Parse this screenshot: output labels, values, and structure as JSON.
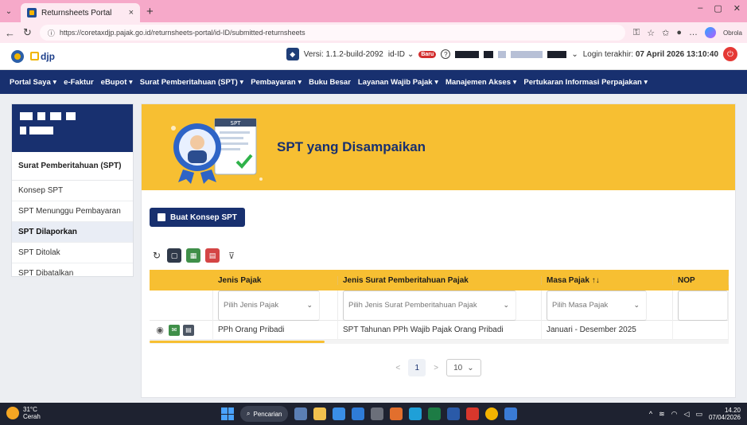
{
  "browser": {
    "tab_title": "Returnsheets Portal",
    "tab_close": "×",
    "new_tab": "+",
    "url": "https://coretaxdjp.pajak.go.id/returnsheets-portal/id-ID/submitted-returnsheets",
    "profile_label": "Obrola"
  },
  "header": {
    "logo_text": "djp",
    "version_label": "Versi: 1.1.2-build-2092",
    "language": "id-ID",
    "new_badge": "Baru",
    "help": "?",
    "login_prefix": "Login terakhir:",
    "login_time": "07 April 2026 13:10:40"
  },
  "menu": [
    "Portal Saya ▾",
    "e-Faktur",
    "eBupot ▾",
    "Surat Pemberitahuan (SPT) ▾",
    "Pembayaran ▾",
    "Buku Besar",
    "Layanan Wajib Pajak ▾",
    "Manajemen Akses ▾",
    "Pertukaran Informasi Perpajakan ▾"
  ],
  "sidebar": {
    "title": "Surat Pemberitahuan (SPT)",
    "items": [
      {
        "label": "Konsep SPT",
        "active": false
      },
      {
        "label": "SPT Menunggu Pembayaran",
        "active": false
      },
      {
        "label": "SPT Dilaporkan",
        "active": true
      },
      {
        "label": "SPT Ditolak",
        "active": false
      },
      {
        "label": "SPT Dibatalkan",
        "active": false
      }
    ]
  },
  "banner": {
    "title": "SPT yang Disampaikan",
    "illus_badge": "SPT"
  },
  "actions": {
    "new_draft": "Buat Konsep SPT"
  },
  "table": {
    "columns": [
      "",
      "Jenis Pajak",
      "Jenis Surat Pemberitahuan Pajak",
      "Masa Pajak ↑↓",
      "NOP"
    ],
    "filters": {
      "jenis_pajak": "Pilih Jenis Pajak",
      "jenis_spt": "Pilih Jenis Surat Pemberitahuan Pajak",
      "masa_pajak": "Pilih Masa Pajak"
    },
    "rows": [
      {
        "jenis_pajak": "PPh Orang Pribadi",
        "jenis_spt": "SPT Tahunan PPh Wajib Pajak Orang Pribadi",
        "masa_pajak": "Januari - Desember 2025",
        "nop": ""
      }
    ]
  },
  "pager": {
    "prev": "<",
    "current": "1",
    "next": ">",
    "page_size": "10"
  },
  "taskbar": {
    "temp": "31°C",
    "weather": "Cerah",
    "search": "Pencarian",
    "time": "14.20",
    "date": "07/04/2026"
  },
  "colors": {
    "navy": "#18306f",
    "amber": "#f7bf32",
    "tab_pink": "#f6a9c9"
  }
}
